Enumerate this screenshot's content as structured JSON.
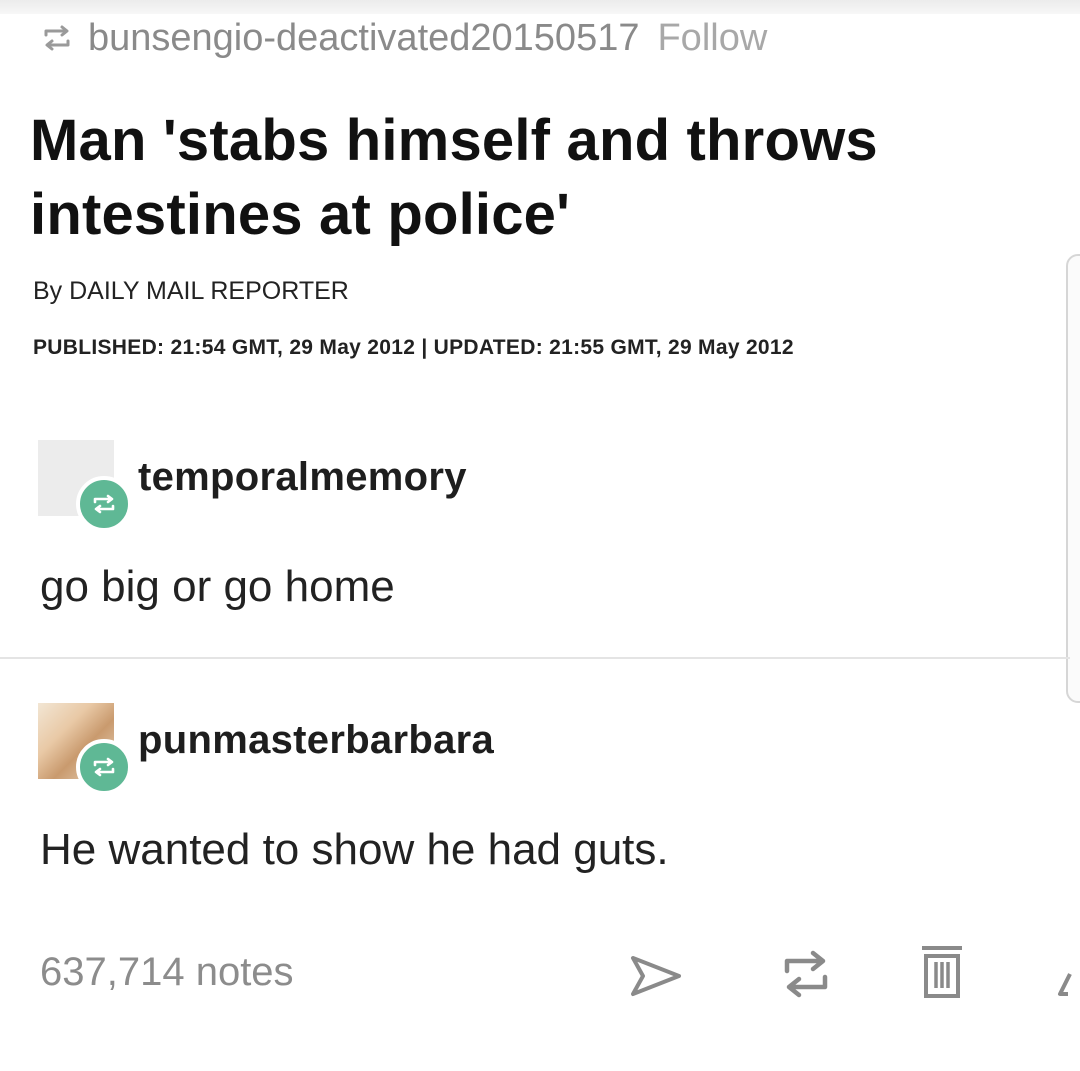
{
  "header": {
    "blog_name": "bunsengio-deactivated20150517",
    "follow_label": "Follow"
  },
  "article": {
    "headline_line1": "Man 'stabs himself and throws",
    "headline_line2": "intestines at police'",
    "byline": "By DAILY MAIL REPORTER",
    "published": "PUBLISHED: 21:54 GMT, 29 May 2012 | UPDATED: 21:55 GMT, 29 May 2012"
  },
  "comments": [
    {
      "username": "temporalmemory",
      "text": "go big or go home"
    },
    {
      "username": "punmasterbarbara",
      "text": "He wanted to show he had guts."
    }
  ],
  "footer": {
    "notes": "637,714 notes",
    "icons": [
      "share-icon",
      "reblog-icon",
      "trash-icon",
      "edit-icon"
    ]
  },
  "colors": {
    "accent_green": "#5fb895",
    "muted_text": "#8c8c8c"
  }
}
